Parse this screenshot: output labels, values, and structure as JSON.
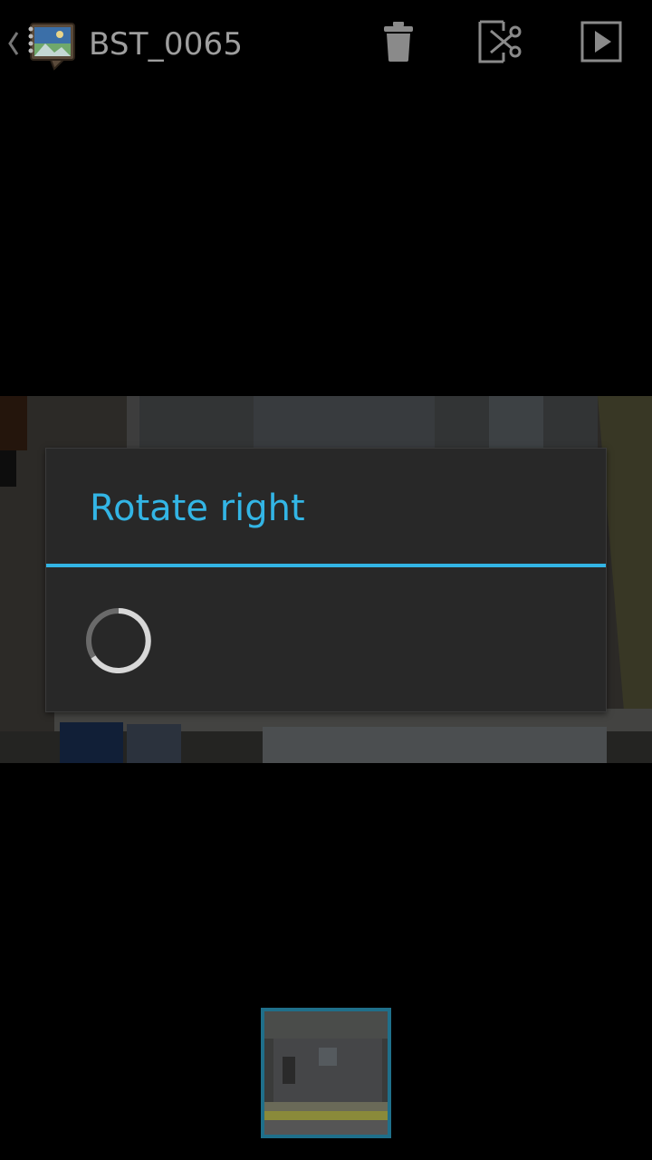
{
  "action_bar": {
    "title": "BST_0065",
    "actions": [
      {
        "name": "delete",
        "icon": "trash-icon"
      },
      {
        "name": "trim",
        "icon": "trim-scissors-icon"
      },
      {
        "name": "play",
        "icon": "play-icon"
      }
    ]
  },
  "dialog": {
    "title": "Rotate right",
    "state": "loading",
    "accent_color": "#33b5e5"
  },
  "colors": {
    "accent": "#33b5e5",
    "dialog_bg": "#282828",
    "title_gray": "#9e9e9e",
    "filmstrip_border": "#1f6f8a"
  }
}
